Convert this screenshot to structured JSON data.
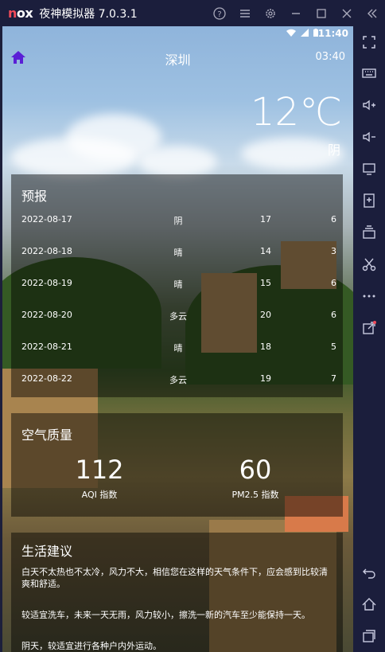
{
  "emulator": {
    "logo": "nox",
    "title": "夜神模拟器 7.0.3.1"
  },
  "status_bar": {
    "time": "11:40"
  },
  "app_bar": {
    "city": "深圳",
    "update_time": "03:40"
  },
  "now": {
    "temperature": "12℃",
    "condition": "阴"
  },
  "forecast": {
    "title": "预报",
    "items": [
      {
        "date": "2022-08-17",
        "weather": "阴",
        "max": "17",
        "min": "6"
      },
      {
        "date": "2022-08-18",
        "weather": "晴",
        "max": "14",
        "min": "3"
      },
      {
        "date": "2022-08-19",
        "weather": "晴",
        "max": "15",
        "min": "6"
      },
      {
        "date": "2022-08-20",
        "weather": "多云",
        "max": "20",
        "min": "6"
      },
      {
        "date": "2022-08-21",
        "weather": "晴",
        "max": "18",
        "min": "5"
      },
      {
        "date": "2022-08-22",
        "weather": "多云",
        "max": "19",
        "min": "7"
      }
    ]
  },
  "aqi": {
    "title": "空气质量",
    "aqi_value": "112",
    "aqi_label": "AQI 指数",
    "pm25_value": "60",
    "pm25_label": "PM2.5 指数"
  },
  "suggestion": {
    "title": "生活建议",
    "comfort": "白天不太热也不太冷，风力不大，相信您在这样的天气条件下，应会感到比较清爽和舒适。",
    "car_wash": "较适宜洗车，未来一天无雨，风力较小，擦洗一新的汽车至少能保持一天。",
    "sport": "阴天，较适宜进行各种户内外运动。"
  },
  "colors": {
    "home_icon": "#5a1fd6",
    "emulator_bg": "#1b1e3c",
    "logo_accent": "#f24b5a"
  }
}
